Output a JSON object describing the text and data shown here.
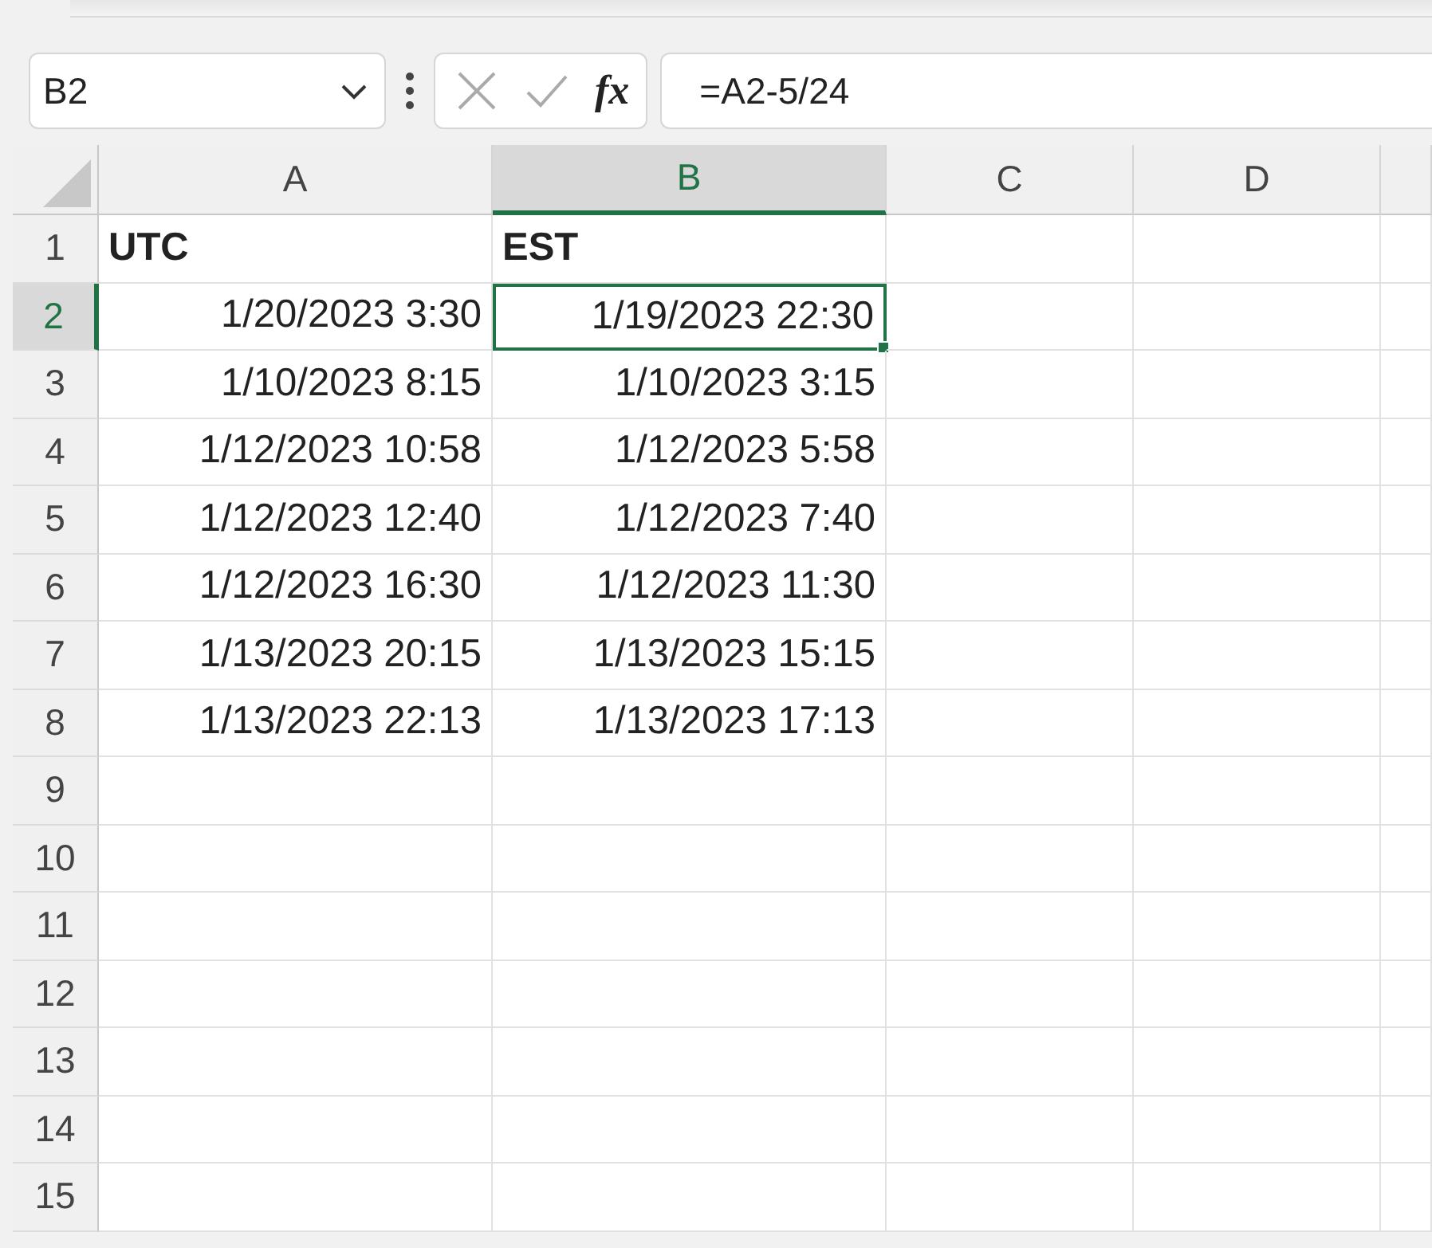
{
  "formula_bar": {
    "name_box": "B2",
    "function_label": "fx",
    "formula": "=A2-5/24"
  },
  "columns": [
    {
      "label": "A",
      "selected": false
    },
    {
      "label": "B",
      "selected": true
    },
    {
      "label": "C",
      "selected": false
    },
    {
      "label": "D",
      "selected": false
    }
  ],
  "rows": [
    {
      "number": "1",
      "selected": false,
      "cells": [
        {
          "text": "UTC",
          "kind": "text",
          "bold": true,
          "selected": false
        },
        {
          "text": "EST",
          "kind": "text",
          "bold": true,
          "selected": false
        }
      ]
    },
    {
      "number": "2",
      "selected": true,
      "cells": [
        {
          "text": "1/20/2023 3:30",
          "kind": "date",
          "bold": false,
          "selected": false
        },
        {
          "text": "1/19/2023 22:30",
          "kind": "date",
          "bold": false,
          "selected": true
        }
      ]
    },
    {
      "number": "3",
      "selected": false,
      "cells": [
        {
          "text": "1/10/2023 8:15",
          "kind": "date",
          "bold": false,
          "selected": false
        },
        {
          "text": "1/10/2023 3:15",
          "kind": "date",
          "bold": false,
          "selected": false
        }
      ]
    },
    {
      "number": "4",
      "selected": false,
      "cells": [
        {
          "text": "1/12/2023 10:58",
          "kind": "date",
          "bold": false,
          "selected": false
        },
        {
          "text": "1/12/2023 5:58",
          "kind": "date",
          "bold": false,
          "selected": false
        }
      ]
    },
    {
      "number": "5",
      "selected": false,
      "cells": [
        {
          "text": "1/12/2023 12:40",
          "kind": "date",
          "bold": false,
          "selected": false
        },
        {
          "text": "1/12/2023 7:40",
          "kind": "date",
          "bold": false,
          "selected": false
        }
      ]
    },
    {
      "number": "6",
      "selected": false,
      "cells": [
        {
          "text": "1/12/2023 16:30",
          "kind": "date",
          "bold": false,
          "selected": false
        },
        {
          "text": "1/12/2023 11:30",
          "kind": "date",
          "bold": false,
          "selected": false
        }
      ]
    },
    {
      "number": "7",
      "selected": false,
      "cells": [
        {
          "text": "1/13/2023 20:15",
          "kind": "date",
          "bold": false,
          "selected": false
        },
        {
          "text": "1/13/2023 15:15",
          "kind": "date",
          "bold": false,
          "selected": false
        }
      ]
    },
    {
      "number": "8",
      "selected": false,
      "cells": [
        {
          "text": "1/13/2023 22:13",
          "kind": "date",
          "bold": false,
          "selected": false
        },
        {
          "text": "1/13/2023 17:13",
          "kind": "date",
          "bold": false,
          "selected": false
        }
      ]
    },
    {
      "number": "9",
      "selected": false,
      "cells": []
    },
    {
      "number": "10",
      "selected": false,
      "cells": []
    },
    {
      "number": "11",
      "selected": false,
      "cells": []
    },
    {
      "number": "12",
      "selected": false,
      "cells": []
    },
    {
      "number": "13",
      "selected": false,
      "cells": []
    },
    {
      "number": "14",
      "selected": false,
      "cells": []
    },
    {
      "number": "15",
      "selected": false,
      "cells": []
    }
  ]
}
